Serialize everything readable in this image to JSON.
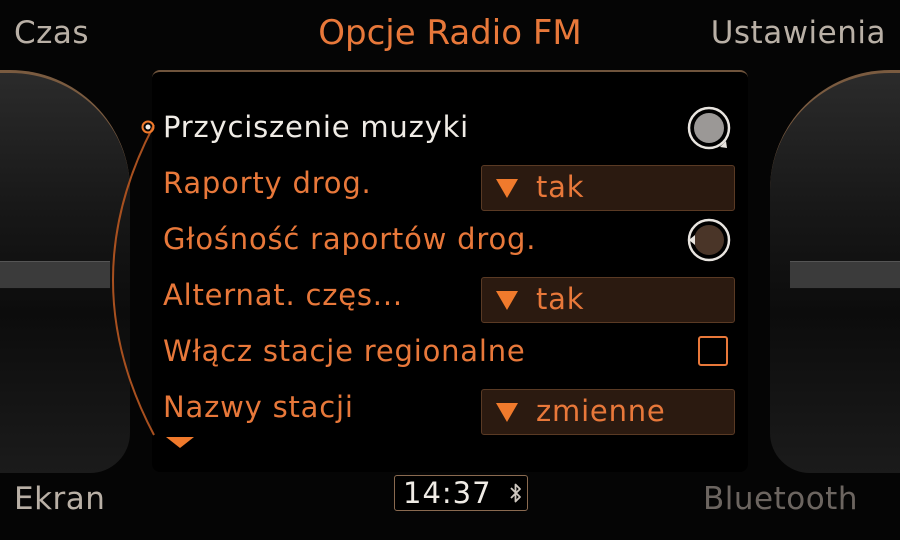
{
  "header": {
    "left_label": "Czas",
    "title": "Opcje Radio FM",
    "right_label": "Ustawienia"
  },
  "footer": {
    "left_label": "Ekran",
    "right_label": "Bluetooth"
  },
  "menu": {
    "items": [
      {
        "label": "Przyciszenie muzyki",
        "control": "knob",
        "selected": true
      },
      {
        "label": "Raporty drog.",
        "control": "dropdown",
        "value": "tak"
      },
      {
        "label": "Głośność raportów drog.",
        "control": "knob"
      },
      {
        "label": "Alternat. częs...",
        "control": "dropdown",
        "value": "tak"
      },
      {
        "label": "Włącz stacje regionalne",
        "control": "checkbox",
        "checked": false
      },
      {
        "label": "Nazwy stacji",
        "control": "dropdown",
        "value": "zmienne"
      }
    ]
  },
  "status": {
    "time": "14:37",
    "bluetooth_icon": "bluetooth-icon"
  },
  "colors": {
    "accent": "#e8783a",
    "selected_text": "#f0ece6",
    "dropdown_bg": "#2b1a10",
    "background": "#000000"
  }
}
